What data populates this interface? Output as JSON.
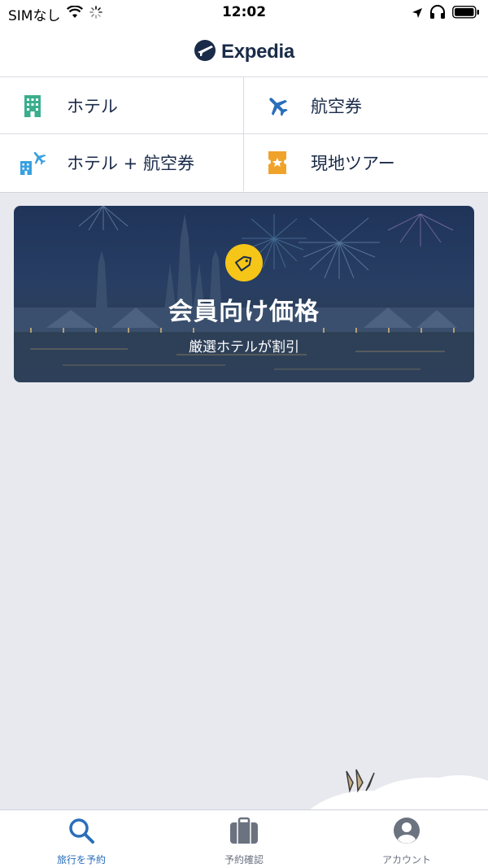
{
  "status_bar": {
    "carrier": "SIMなし",
    "time": "12:02"
  },
  "header": {
    "brand": "Expedia",
    "brand_color": "#1a2b49"
  },
  "menu": [
    {
      "label": "ホテル",
      "icon": "hotel-building-icon",
      "color": "#3bae8e"
    },
    {
      "label": "航空券",
      "icon": "airplane-icon",
      "color": "#2a6ebb"
    },
    {
      "label": "ホテル + 航空券",
      "icon": "hotel-plus-flight-icon",
      "color": "#3aa0e0"
    },
    {
      "label": "現地ツアー",
      "icon": "ticket-star-icon",
      "color": "#f0a32b"
    }
  ],
  "promo": {
    "title": "会員向け価格",
    "subtitle": "厳選ホテルが割引",
    "badge_icon": "price-tag-icon",
    "badge_color": "#f5c518"
  },
  "tabbar": {
    "active_color": "#2a6ebb",
    "tabs": [
      {
        "label": "旅行を予約",
        "icon": "search-icon",
        "active": true
      },
      {
        "label": "予約確認",
        "icon": "suitcase-icon",
        "active": false
      },
      {
        "label": "アカウント",
        "icon": "account-icon",
        "active": false
      }
    ]
  }
}
